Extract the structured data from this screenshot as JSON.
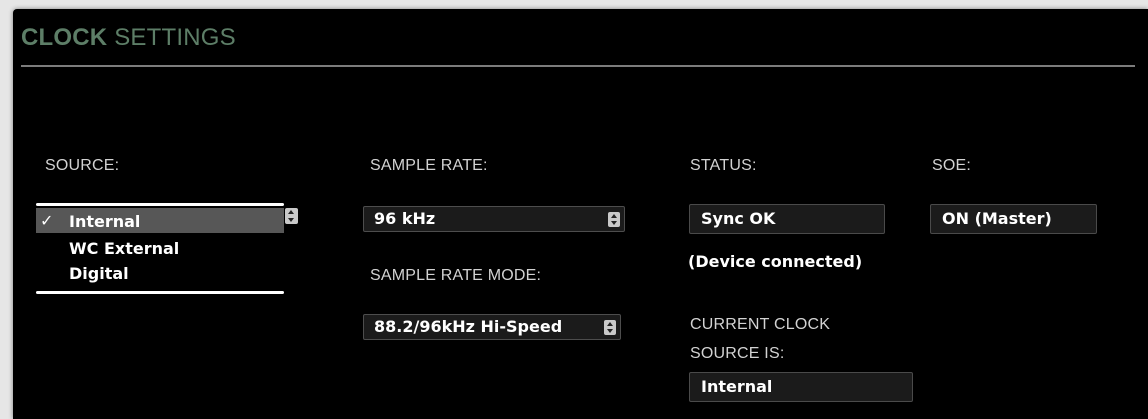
{
  "panel": {
    "title_strong": "CLOCK",
    "title_light": " SETTINGS",
    "accent_color": "#5d7e67"
  },
  "source": {
    "label": "SOURCE:",
    "options": [
      "Internal",
      "WC External",
      "Digital"
    ],
    "selected": "Internal",
    "check_glyph": "✓",
    "menu_open": true
  },
  "sample_rate": {
    "label": "SAMPLE RATE:",
    "value": "96 kHz"
  },
  "sample_rate_mode": {
    "label": "SAMPLE RATE MODE:",
    "value": "88.2/96kHz Hi-Speed"
  },
  "status": {
    "label": "STATUS:",
    "value": "Sync OK",
    "note": "(Device connected)"
  },
  "current_clock": {
    "label_line1": "CURRENT CLOCK",
    "label_line2": "SOURCE IS:",
    "value": "Internal"
  },
  "soe": {
    "label": "SOE:",
    "value": "ON (Master)"
  }
}
